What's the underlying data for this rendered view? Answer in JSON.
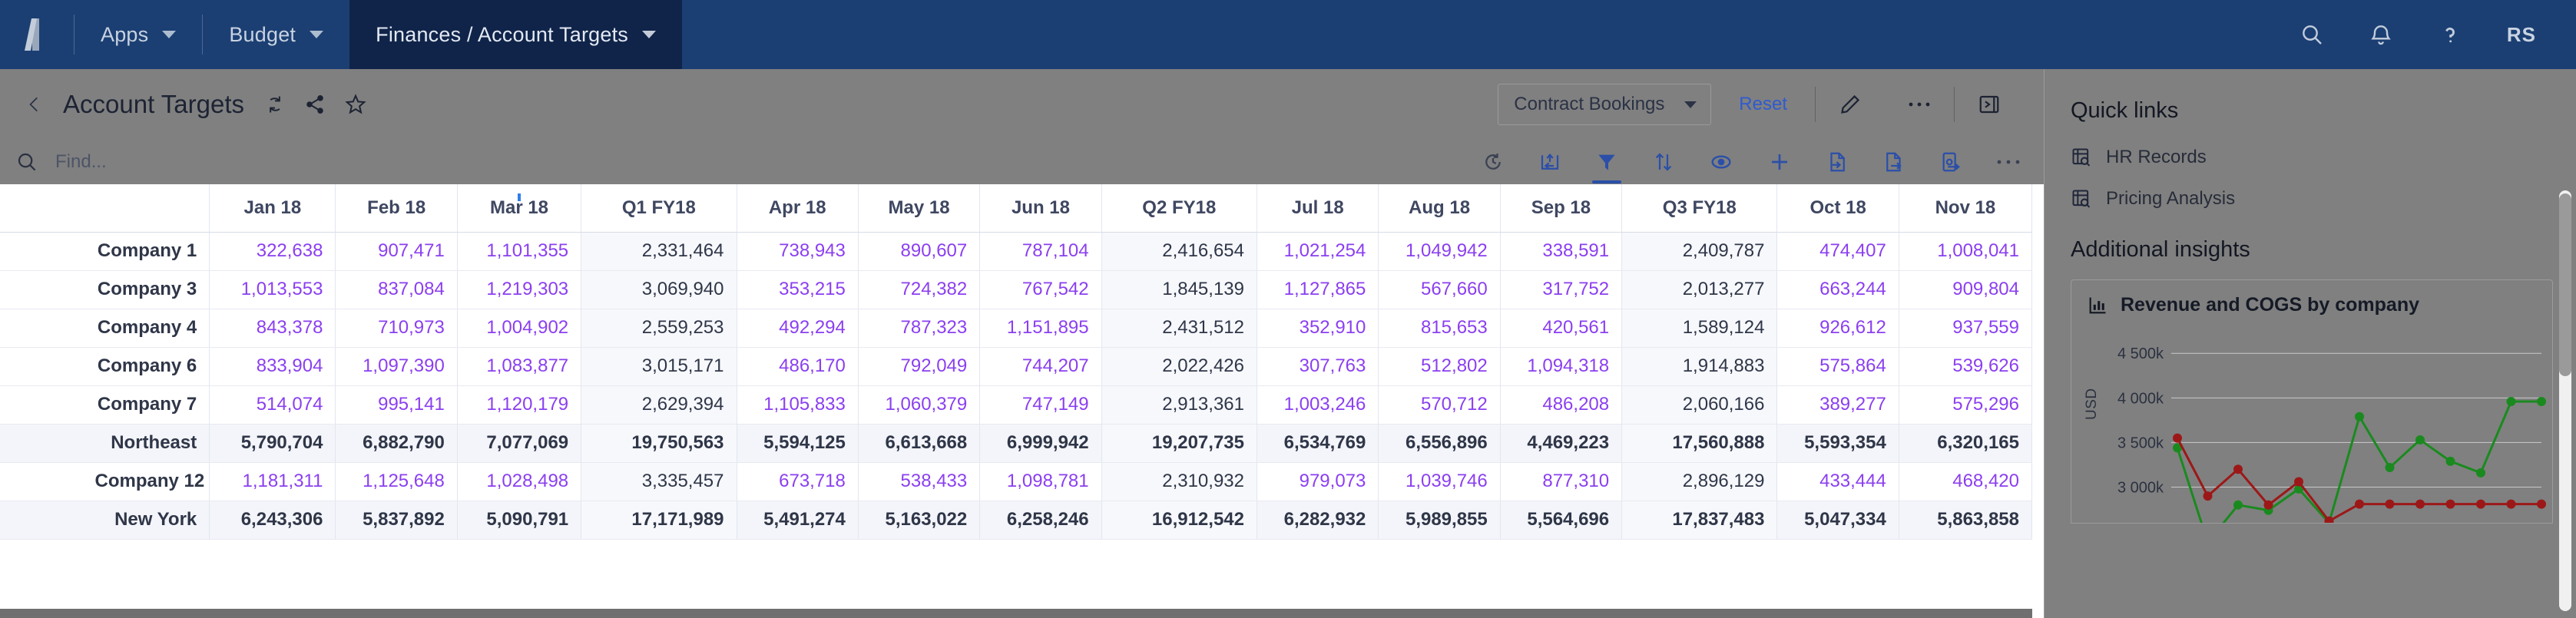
{
  "topnav": {
    "logo_icon": "anaplan-logo-icon",
    "items": [
      {
        "label": "Apps",
        "icon": "chevron-down-icon",
        "active": false
      },
      {
        "label": "Budget",
        "icon": "chevron-down-icon",
        "active": false
      },
      {
        "label": "Finances / Account Targets",
        "icon": "chevron-down-icon",
        "active": true
      }
    ],
    "actions": [
      {
        "name": "search-icon",
        "label": "Search"
      },
      {
        "name": "notifications-bell-icon",
        "label": "Notifications"
      },
      {
        "name": "help-question-icon",
        "label": "Help"
      }
    ],
    "avatar_initials": "RS",
    "bg_color": "#1b3f73",
    "active_bg_color": "#10244a"
  },
  "pagehead": {
    "back_label": "Back",
    "title": "Account Targets",
    "icons": [
      {
        "name": "refresh-sync-icon"
      },
      {
        "name": "share-icon"
      },
      {
        "name": "favorite-star-icon"
      }
    ],
    "context_selector": {
      "value": "Contract Bookings",
      "caret": "chevron-down-icon"
    },
    "reset_label": "Reset",
    "edit_icon": "pencil-edit-icon",
    "more_icon": "more-horizontal-icon",
    "panel_toggle_icon": "collapse-right-panel-icon"
  },
  "toolbar": {
    "search_icon": "search-icon",
    "find_placeholder": "Find...",
    "find_value": "",
    "icons": [
      {
        "name": "history-clock-icon",
        "active": false
      },
      {
        "name": "pivot-icon",
        "active": false
      },
      {
        "name": "filter-icon",
        "active": true
      },
      {
        "name": "sort-icon",
        "active": false
      },
      {
        "name": "show-hide-eye-icon",
        "active": false
      },
      {
        "name": "add-plus-icon",
        "active": false
      },
      {
        "name": "import-icon",
        "active": false
      },
      {
        "name": "export-icon",
        "active": false
      },
      {
        "name": "export-action-icon",
        "active": false
      },
      {
        "name": "more-horizontal-icon",
        "active": false
      }
    ]
  },
  "grid": {
    "filtered_column": "Mar 18",
    "columns": [
      {
        "label": "",
        "type": "rowheader"
      },
      {
        "label": "Jan 18",
        "type": "month"
      },
      {
        "label": "Feb 18",
        "type": "month"
      },
      {
        "label": "Mar 18",
        "type": "month",
        "filtered": true
      },
      {
        "label": "Q1 FY18",
        "type": "quarter"
      },
      {
        "label": "Apr 18",
        "type": "month"
      },
      {
        "label": "May 18",
        "type": "month"
      },
      {
        "label": "Jun 18",
        "type": "month"
      },
      {
        "label": "Q2 FY18",
        "type": "quarter"
      },
      {
        "label": "Jul 18",
        "type": "month"
      },
      {
        "label": "Aug 18",
        "type": "month"
      },
      {
        "label": "Sep 18",
        "type": "month"
      },
      {
        "label": "Q3 FY18",
        "type": "quarter"
      },
      {
        "label": "Oct 18",
        "type": "month"
      },
      {
        "label": "Nov 18",
        "type": "month"
      }
    ],
    "rows": [
      {
        "label": "Company 1",
        "total": false,
        "indent": false,
        "values": [
          "322,638",
          "907,471",
          "1,101,355",
          "2,331,464",
          "738,943",
          "890,607",
          "787,104",
          "2,416,654",
          "1,021,254",
          "1,049,942",
          "338,591",
          "2,409,787",
          "474,407",
          "1,008,041"
        ]
      },
      {
        "label": "Company 3",
        "total": false,
        "indent": false,
        "values": [
          "1,013,553",
          "837,084",
          "1,219,303",
          "3,069,940",
          "353,215",
          "724,382",
          "767,542",
          "1,845,139",
          "1,127,865",
          "567,660",
          "317,752",
          "2,013,277",
          "663,244",
          "909,804"
        ]
      },
      {
        "label": "Company 4",
        "total": false,
        "indent": false,
        "values": [
          "843,378",
          "710,973",
          "1,004,902",
          "2,559,253",
          "492,294",
          "787,323",
          "1,151,895",
          "2,431,512",
          "352,910",
          "815,653",
          "420,561",
          "1,589,124",
          "926,612",
          "937,559"
        ]
      },
      {
        "label": "Company 6",
        "total": false,
        "indent": false,
        "values": [
          "833,904",
          "1,097,390",
          "1,083,877",
          "3,015,171",
          "486,170",
          "792,049",
          "744,207",
          "2,022,426",
          "307,763",
          "512,802",
          "1,094,318",
          "1,914,883",
          "575,864",
          "539,626"
        ]
      },
      {
        "label": "Company 7",
        "total": false,
        "indent": false,
        "values": [
          "514,074",
          "995,141",
          "1,120,179",
          "2,629,394",
          "1,105,833",
          "1,060,379",
          "747,149",
          "2,913,361",
          "1,003,246",
          "570,712",
          "486,208",
          "2,060,166",
          "389,277",
          "575,296"
        ]
      },
      {
        "label": "Northeast",
        "total": true,
        "indent": false,
        "values": [
          "5,790,704",
          "6,882,790",
          "7,077,069",
          "19,750,563",
          "5,594,125",
          "6,613,668",
          "6,999,942",
          "19,207,735",
          "6,534,769",
          "6,556,896",
          "4,469,223",
          "17,560,888",
          "5,593,354",
          "6,320,165"
        ]
      },
      {
        "label": "Company 12",
        "total": false,
        "indent": true,
        "values": [
          "1,181,311",
          "1,125,648",
          "1,028,498",
          "3,335,457",
          "673,718",
          "538,433",
          "1,098,781",
          "2,310,932",
          "979,073",
          "1,039,746",
          "877,310",
          "2,896,129",
          "433,444",
          "468,420"
        ]
      },
      {
        "label": "New York",
        "total": true,
        "indent": false,
        "values": [
          "6,243,306",
          "5,837,892",
          "5,090,791",
          "17,171,989",
          "5,491,274",
          "5,163,022",
          "6,258,246",
          "16,912,542",
          "6,282,932",
          "5,989,855",
          "5,564,696",
          "17,837,483",
          "5,047,334",
          "5,863,858"
        ]
      }
    ]
  },
  "rightpanel": {
    "quick_links_title": "Quick links",
    "links": [
      {
        "label": "HR Records",
        "icon": "module-grid-search-icon"
      },
      {
        "label": "Pricing Analysis",
        "icon": "module-grid-search-icon"
      }
    ],
    "insights_title": "Additional insights",
    "card": {
      "icon": "bar-chart-icon",
      "title": "Revenue and COGS by company"
    }
  },
  "chart_data": {
    "type": "line",
    "title": "Revenue and COGS by company",
    "xlabel": "",
    "ylabel": "USD",
    "ylim": [
      2600,
      4700
    ],
    "ytick_labels": [
      "3 000k",
      "3 500k",
      "4 000k",
      "4 500k"
    ],
    "yticks": [
      3000,
      3500,
      4000,
      4500
    ],
    "grid": true,
    "legend_position": "none",
    "x": [
      1,
      2,
      3,
      4,
      5,
      6,
      7,
      8,
      9,
      10,
      11,
      12,
      13
    ],
    "series": [
      {
        "name": "Revenue",
        "color": "#1a8a1f",
        "values": [
          3440,
          2380,
          2800,
          2740,
          2980,
          2600,
          3790,
          3220,
          3530,
          3290,
          3160,
          3960,
          3960
        ]
      },
      {
        "name": "COGS",
        "color": "#9c1818",
        "values": [
          3550,
          2900,
          3200,
          2800,
          3060,
          2620,
          2810,
          2810,
          2810,
          2810,
          2810,
          2810,
          2810
        ]
      }
    ]
  },
  "colors": {
    "nav_bg": "#1b3f73",
    "nav_active": "#10244a",
    "overlay": "#808080",
    "editable_value": "#8b3ff0",
    "calculated_value": "#2f3648",
    "accent_blue": "#2b4fa8",
    "filter_blue": "#2f7fe8",
    "series_green": "#1a8a1f",
    "series_red": "#9c1818"
  }
}
